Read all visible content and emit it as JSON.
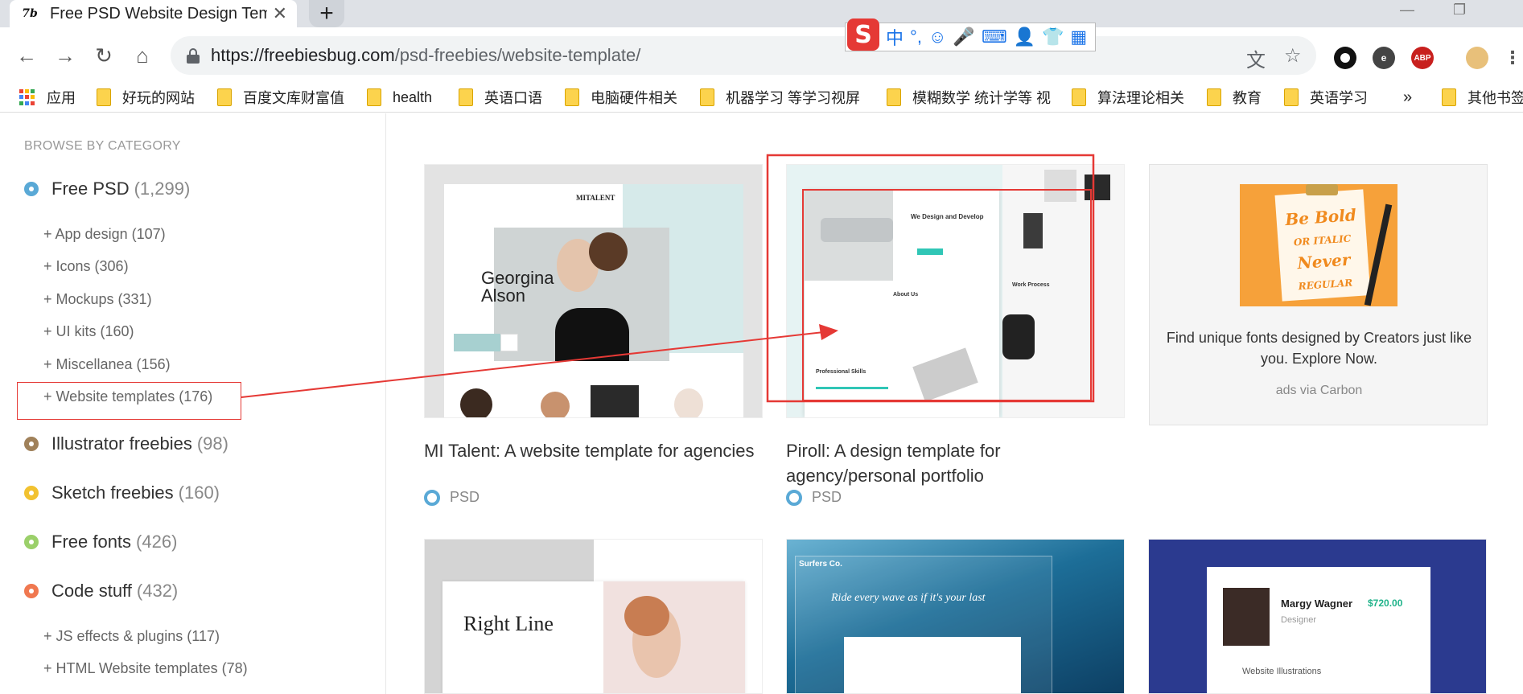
{
  "tab": {
    "title": "Free PSD Website Design Tem",
    "favicon": "7b",
    "close": "✕"
  },
  "new_tab": "+",
  "toolbar": {
    "back": "←",
    "forward": "→",
    "reload": "↻",
    "home": "⌂"
  },
  "address": {
    "host": "https://freebiesbug.com",
    "path": "/psd-freebies/website-template/"
  },
  "ime": {
    "logo": "S",
    "items": [
      "中",
      "°,",
      "☺",
      "🎤",
      "⌨",
      "👤",
      "👕",
      "▦"
    ]
  },
  "bookmarks": [
    "应用",
    "好玩的网站",
    "百度文库财富值",
    "health",
    "英语口语",
    "电脑硬件相关",
    "机器学习 等学习视屏",
    "模糊数学 统计学等 视",
    "算法理论相关",
    "教育",
    "英语学习",
    "»",
    "其他书签"
  ],
  "sidebar": {
    "heading": "BROWSE BY CATEGORY",
    "categories": [
      {
        "name": "Free PSD",
        "count": "(1,299)",
        "color": "#5aa9d6"
      },
      {
        "name": "Illustrator freebies",
        "count": "(98)",
        "color": "#a0815a"
      },
      {
        "name": "Sketch freebies",
        "count": "(160)",
        "color": "#f2c230"
      },
      {
        "name": "Free fonts",
        "count": "(426)",
        "color": "#9bd06a"
      },
      {
        "name": "Code stuff",
        "count": "(432)",
        "color": "#f07850"
      }
    ],
    "sub_psd": [
      "+ App design (107)",
      "+ Icons (306)",
      "+ Mockups (331)",
      "+ UI kits (160)",
      "+ Miscellanea (156)",
      "+ Website templates (176)"
    ],
    "sub_code": [
      "+ JS effects & plugins (117)",
      "+ HTML Website templates (78)"
    ]
  },
  "cards": [
    {
      "title": "MI Talent: A website template for agencies",
      "tag": "PSD",
      "thumb_logo": "MITALENT",
      "thumb_name_1": "Georgina",
      "thumb_name_2": "Alson"
    },
    {
      "title": "Piroll: A design template for agency/personal portfolio",
      "tag": "PSD",
      "thumb_h1": "We Design and Develop",
      "thumb_h2": "About Us",
      "thumb_h3": "Professional Skills",
      "thumb_h4": "Work Process"
    }
  ],
  "row2": {
    "card1_text": "Right Line",
    "card2_brand": "Surfers Co.",
    "card2_tagline": "Ride every wave as if it's your last",
    "card3_name": "Margy Wagner",
    "card3_role": "Designer",
    "card3_price": "$720.00",
    "card3_link": "Website Illustrations"
  },
  "ad": {
    "image_text": "Be Bold OR ITALIC Never REGULAR",
    "text": "Find unique fonts designed by Creators just like you. Explore Now.",
    "via": "ads via Carbon"
  },
  "colors": {
    "annotation": "#e53935",
    "psd": "#5aa9d6"
  }
}
